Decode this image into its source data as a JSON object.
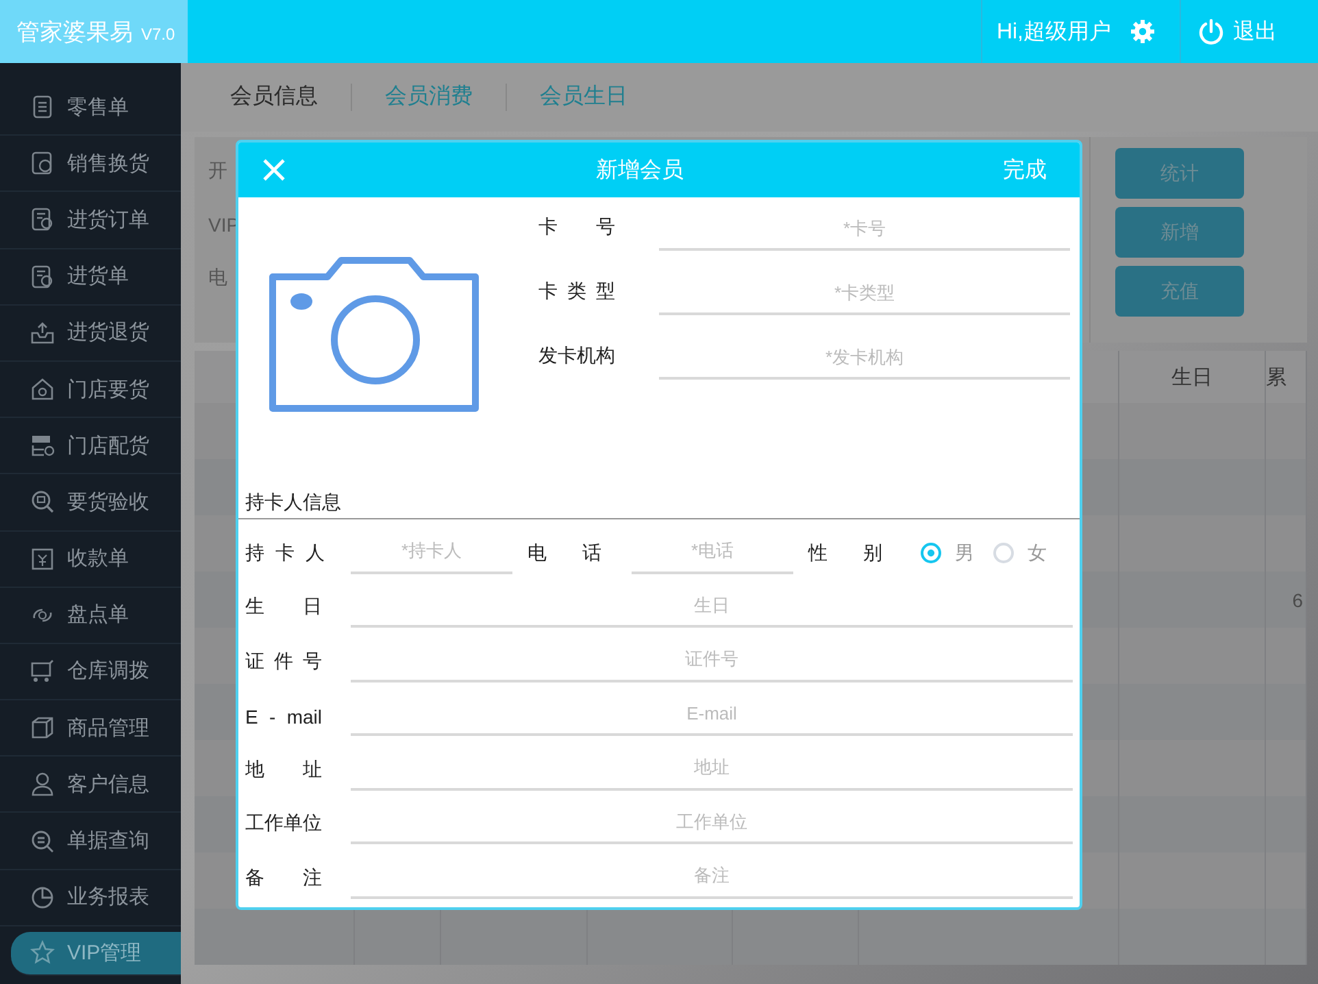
{
  "header": {
    "app_name": "管家婆果易",
    "version": "V7.0",
    "greeting": "Hi,超级用户",
    "logout": "退出"
  },
  "sidebar": {
    "items": [
      {
        "label": "零售单",
        "selected": false
      },
      {
        "label": "销售换货",
        "selected": false
      },
      {
        "label": "进货订单",
        "selected": false
      },
      {
        "label": "进货单",
        "selected": false
      },
      {
        "label": "进货退货",
        "selected": false
      },
      {
        "label": "门店要货",
        "selected": false
      },
      {
        "label": "门店配货",
        "selected": false
      },
      {
        "label": "要货验收",
        "selected": false
      },
      {
        "label": "收款单",
        "selected": false
      },
      {
        "label": "盘点单",
        "selected": false
      },
      {
        "label": "仓库调拨",
        "selected": false
      },
      {
        "label": "商品管理",
        "selected": false
      },
      {
        "label": "客户信息",
        "selected": false
      },
      {
        "label": "单据查询",
        "selected": false
      },
      {
        "label": "业务报表",
        "selected": false
      },
      {
        "label": "VIP管理",
        "selected": true
      }
    ]
  },
  "tabs": [
    {
      "label": "会员信息",
      "selected": true
    },
    {
      "label": "会员消费",
      "selected": false
    },
    {
      "label": "会员生日",
      "selected": false
    }
  ],
  "filters": {
    "labels": [
      "开",
      "VIP",
      "电"
    ]
  },
  "buttons": [
    "统计",
    "新增",
    "充值"
  ],
  "table": {
    "columns": [
      "生日",
      "累"
    ],
    "cells": [
      "6"
    ]
  },
  "dialog": {
    "title": "新增会员",
    "done": "完成",
    "card_fields": [
      {
        "label": "卡号",
        "placeholder": "*卡号"
      },
      {
        "label": "卡类型",
        "placeholder": "*卡类型"
      },
      {
        "label": "发卡机构",
        "placeholder": "*发卡机构"
      }
    ],
    "section": "持卡人信息",
    "holder": {
      "label": "持卡人",
      "placeholder": "*持卡人"
    },
    "phone": {
      "label": "电话",
      "placeholder": "*电话"
    },
    "gender": {
      "label": "性别",
      "options": [
        {
          "label": "男",
          "selected": true
        },
        {
          "label": "女",
          "selected": false
        }
      ]
    },
    "fields": [
      {
        "label": "生日",
        "placeholder": "生日"
      },
      {
        "label": "证件号",
        "placeholder": "证件号"
      },
      {
        "label": "E - mail",
        "placeholder": "E-mail"
      },
      {
        "label": "地址",
        "placeholder": "地址"
      },
      {
        "label": "工作单位",
        "placeholder": "工作单位"
      },
      {
        "label": "备注",
        "placeholder": "备注"
      }
    ]
  }
}
